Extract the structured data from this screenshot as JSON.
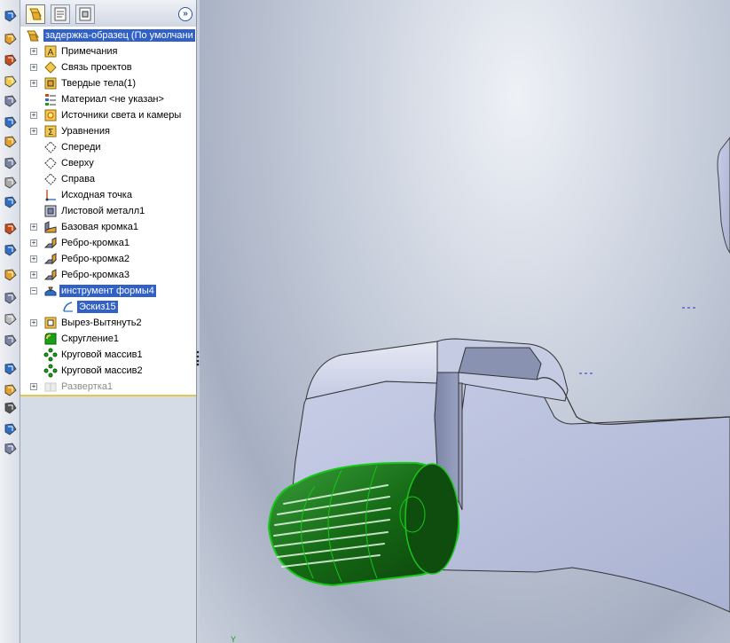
{
  "panel": {
    "tabs": [
      {
        "name": "feature-manager-tab",
        "icon": "feature-tree-icon"
      },
      {
        "name": "property-manager-tab",
        "icon": "properties-icon"
      },
      {
        "name": "configuration-manager-tab",
        "icon": "configuration-icon"
      }
    ],
    "expand_label": "»"
  },
  "tree": {
    "root": "задержка-образец  (По умолчани",
    "items": [
      {
        "label": "Примечания",
        "icon": "annotations-icon",
        "expandable": true
      },
      {
        "label": "Связь проектов",
        "icon": "design-binder-icon",
        "expandable": true
      },
      {
        "label": "Твердые тела(1)",
        "icon": "solid-bodies-icon",
        "expandable": true
      },
      {
        "label": "Материал <не указан>",
        "icon": "material-icon",
        "expandable": false
      },
      {
        "label": "Источники света и камеры",
        "icon": "lights-cameras-icon",
        "expandable": true
      },
      {
        "label": "Уравнения",
        "icon": "equations-icon",
        "expandable": true
      },
      {
        "label": "Спереди",
        "icon": "plane-icon",
        "expandable": false
      },
      {
        "label": "Сверху",
        "icon": "plane-icon",
        "expandable": false
      },
      {
        "label": "Справа",
        "icon": "plane-icon",
        "expandable": false
      },
      {
        "label": "Исходная точка",
        "icon": "origin-icon",
        "expandable": false
      },
      {
        "label": "Листовой металл1",
        "icon": "sheet-metal-icon",
        "expandable": false
      },
      {
        "label": "Базовая кромка1",
        "icon": "base-flange-icon",
        "expandable": true
      },
      {
        "label": "Ребро-кромка1",
        "icon": "edge-flange-icon",
        "expandable": true
      },
      {
        "label": "Ребро-кромка2",
        "icon": "edge-flange-icon",
        "expandable": true
      },
      {
        "label": "Ребро-кромка3",
        "icon": "edge-flange-icon",
        "expandable": true
      },
      {
        "label": "инструмент формы4",
        "icon": "forming-tool-icon",
        "expandable": true,
        "expanded": true,
        "selected": true
      },
      {
        "label": "Эскиз15",
        "icon": "sketch-icon",
        "expandable": false,
        "child": true,
        "selected": true
      },
      {
        "label": "Вырез-Вытянуть2",
        "icon": "cut-extrude-icon",
        "expandable": true
      },
      {
        "label": "Скругление1",
        "icon": "fillet-icon",
        "expandable": false
      },
      {
        "label": "Круговой массив1",
        "icon": "circular-pattern-icon",
        "expandable": false
      },
      {
        "label": "Круговой массив2",
        "icon": "circular-pattern-icon",
        "expandable": false
      },
      {
        "label": "Развертка1",
        "icon": "flatten-icon",
        "expandable": true,
        "suppressed": true
      }
    ]
  },
  "toolbar": {
    "buttons": [
      "base-flange-icon",
      "convert-to-sheet-metal-icon",
      "miter-flange-icon",
      "hem-icon",
      "edge-flange-icon",
      "sketched-bend-icon",
      "jog-icon",
      "closed-corner-icon",
      "break-corner-icon",
      "forming-tool-icon",
      "insert-bends-icon",
      "unfold-icon",
      "fold-icon",
      "flatten-icon",
      "no-bends-icon",
      "rip-icon",
      "lofted-bend-icon",
      "cross-break-icon",
      "vent-icon",
      "corner-relief-icon",
      "flat-pattern-icon"
    ]
  },
  "viewport": {
    "axis_label": "Y",
    "highlight_color": "#19c619",
    "model_color": "#bcc3e0"
  },
  "colors": {
    "selection": "#3160c6",
    "tree_border": "#e3c84a"
  }
}
